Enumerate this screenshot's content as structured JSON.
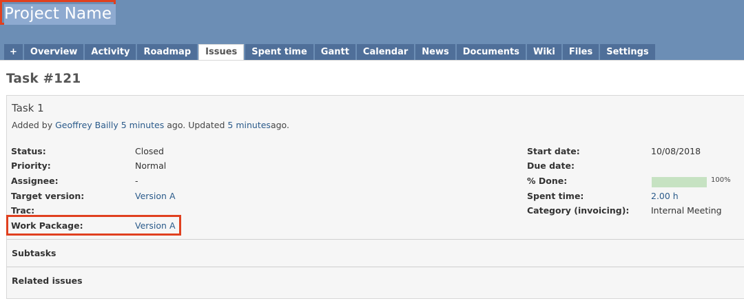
{
  "project": {
    "name": "Project Name"
  },
  "tabs": [
    {
      "label": "+"
    },
    {
      "label": "Overview"
    },
    {
      "label": "Activity"
    },
    {
      "label": "Roadmap"
    },
    {
      "label": "Issues",
      "selected": true
    },
    {
      "label": "Spent time"
    },
    {
      "label": "Gantt"
    },
    {
      "label": "Calendar"
    },
    {
      "label": "News"
    },
    {
      "label": "Documents"
    },
    {
      "label": "Wiki"
    },
    {
      "label": "Files"
    },
    {
      "label": "Settings"
    }
  ],
  "issue": {
    "heading": "Task #121",
    "subject": "Task 1",
    "meta": {
      "added_by_prefix": "Added by",
      "author": "Geoffrey Bailly",
      "created_ago": "5 minutes",
      "middle": "ago. Updated",
      "updated_ago": "5 minutes",
      "suffix": "ago."
    },
    "fields_left": [
      {
        "label": "Status:",
        "value": "Closed",
        "link": false
      },
      {
        "label": "Priority:",
        "value": "Normal",
        "link": false
      },
      {
        "label": "Assignee:",
        "value": "-",
        "link": false
      },
      {
        "label": "Target version:",
        "value": "Version A",
        "link": true
      },
      {
        "label": "Trac:",
        "value": "",
        "link": false
      },
      {
        "label": "Work Package:",
        "value": "Version A",
        "link": true
      }
    ],
    "fields_right": [
      {
        "label": "Start date:",
        "value": "10/08/2018",
        "link": false
      },
      {
        "label": "Due date:",
        "value": "",
        "link": false
      },
      {
        "label": "% Done:",
        "value": "100%",
        "link": false
      },
      {
        "label": "Spent time:",
        "value": "2.00 h",
        "link": true
      },
      {
        "label": "Category (invoicing):",
        "value": "Internal Meeting",
        "link": false
      }
    ],
    "done_ratio": 1.0,
    "sections": {
      "subtasks": "Subtasks",
      "related": "Related issues"
    }
  },
  "colors": {
    "header_bg": "#6c8eb5",
    "tab_bg": "#4f6f99",
    "highlight": "#e0401f",
    "link": "#2a5a8a",
    "progress_done": "#c6e2c2"
  }
}
